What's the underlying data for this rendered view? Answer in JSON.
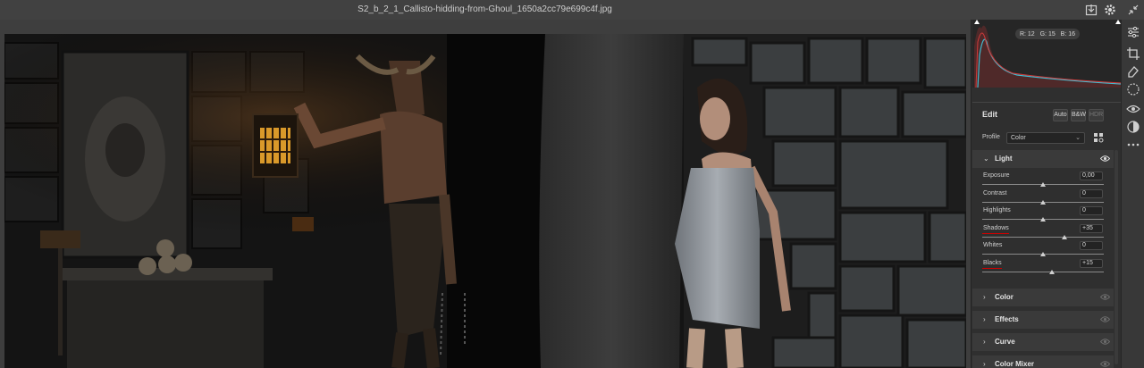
{
  "titlebar": {
    "filename": "S2_b_2_1_Callisto-hidding-from-Ghoul_1650a2cc79e699c4f.jpg",
    "icons": [
      "save-icon",
      "gear-icon",
      "collapse-icon"
    ]
  },
  "histogram": {
    "r_label": "R: 12",
    "g_label": "G: 15",
    "b_label": "B: 16"
  },
  "edit": {
    "title": "Edit",
    "auto_label": "Auto",
    "bw_label": "B&W",
    "hdr_label": "HDR",
    "profile_label": "Profile",
    "profile_value": "Color"
  },
  "light": {
    "title": "Light",
    "sliders": [
      {
        "label": "Exposure",
        "value": "0,00",
        "level": 0.5
      },
      {
        "label": "Contrast",
        "value": "0",
        "level": 0.5
      },
      {
        "label": "Highlights",
        "value": "0",
        "level": 0.5
      },
      {
        "label": "Shadows",
        "value": "+35",
        "level": 0.675
      },
      {
        "label": "Whites",
        "value": "0",
        "level": 0.5
      },
      {
        "label": "Blacks",
        "value": "+15",
        "level": 0.575
      }
    ]
  },
  "sections": [
    {
      "title": "Color"
    },
    {
      "title": "Effects"
    },
    {
      "title": "Curve"
    },
    {
      "title": "Color Mixer"
    }
  ],
  "tools": [
    "edit-sliders-icon",
    "crop-icon",
    "heal-icon",
    "masking-icon",
    "red-eye-icon",
    "presets-icon",
    "more-icon"
  ],
  "colors": {
    "accent_underline": "#d00000",
    "panel_bg": "#2f2f2f",
    "section_bg": "#3a3a3a"
  }
}
